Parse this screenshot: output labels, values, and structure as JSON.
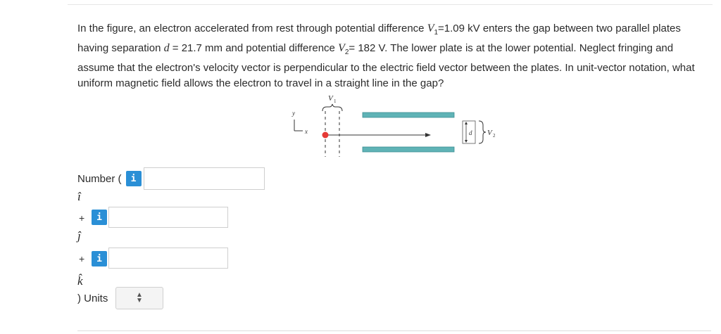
{
  "question": {
    "part1": "In the figure, an electron accelerated from rest through potential difference ",
    "v1_sym": "V",
    "v1_sub": "1",
    "part2": "=1.09 kV enters the gap between two parallel plates having separation ",
    "d_sym": "d",
    "part3": " = 21.7 mm and potential difference ",
    "v2_sym": "V",
    "v2_sub": "2",
    "part4": "= 182 V. The lower plate is at the lower potential. Neglect fringing and assume that the electron's velocity vector is perpendicular to the electric field vector between the plates. In unit-vector notation, what uniform magnetic field allows the electron to travel in a straight line in the gap?"
  },
  "figure": {
    "v1_label": "V",
    "v1_sub": "1",
    "y_label": "y",
    "x_label": "x",
    "d_label": "d",
    "v2_label": "V",
    "v2_sub": "2",
    "plate_color": "#5fb3b6",
    "electron_color": "#e53935"
  },
  "answer": {
    "number_label": "Number (",
    "info_label": "i",
    "i_hat": "î",
    "j_hat": "ĵ",
    "k_hat": "k̂",
    "plus": "+",
    "units_label": ") Units",
    "field_i": "",
    "field_j": "",
    "field_k": "",
    "units_value": ""
  },
  "colors": {
    "accent": "#2a8fd6"
  }
}
